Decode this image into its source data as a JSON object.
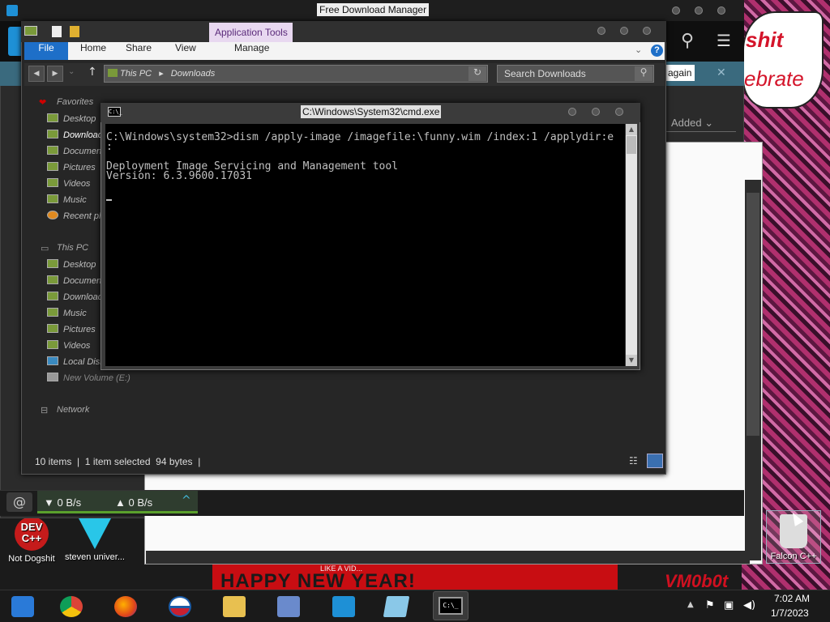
{
  "fdm": {
    "title": "Free Download Manager",
    "info_button": "again",
    "close_info": "✕",
    "column_added": "Added ⌄",
    "speed_down": "0 B/s",
    "speed_up": "0 B/s"
  },
  "explorer": {
    "ribbon_context": "Application Tools",
    "tabs": {
      "file": "File",
      "home": "Home",
      "share": "Share",
      "view": "View",
      "manage": "Manage"
    },
    "help": "?",
    "address": {
      "root": "This PC",
      "current": "Downloads"
    },
    "search_placeholder": "Search Downloads",
    "nav": {
      "favorites": "Favorites",
      "fav_items": [
        "Desktop",
        "Downloads",
        "Documents",
        "Pictures",
        "Videos",
        "Music",
        "Recent places"
      ],
      "this_pc": "This PC",
      "pc_items": [
        "Desktop",
        "Documents",
        "Downloads",
        "Music",
        "Pictures",
        "Videos",
        "Local Disk",
        "New Volume (E:)"
      ],
      "network": "Network"
    },
    "status": "10 items  |  1 item selected  94 bytes  |"
  },
  "cmd": {
    "title": "C:\\Windows\\System32\\cmd.exe",
    "icon_text": "C:\\_",
    "lines": "C:\\Windows\\system32>dism /apply-image /imagefile:\\funny.wim /index:1 /applydir:e\n:\n\nDeployment Image Servicing and Management tool\nVersion: 6.3.9600.17031"
  },
  "desktop": {
    "icons": {
      "devcpp": "Not Dogshit",
      "gem": "steven univer...",
      "recycle": "Falcon C++"
    },
    "devcpp_glyph": "DEV C++",
    "meme_line1": "shit",
    "meme_line2": "ebrate",
    "banner_sub": "LIKE A VID...",
    "banner_text": "HAPPY NEW YEAR!",
    "watermark": "VM0b0t"
  },
  "taskbar": {
    "apps": [
      "chrome-launcher",
      "chrome",
      "firefox",
      "obama-app",
      "file-explorer",
      "network-users",
      "fdm",
      "notepad",
      "cmd"
    ],
    "time": "7:02 AM",
    "date": "1/7/2023"
  },
  "colors": {
    "accent": "#1e6fc8",
    "console_bg": "#000000",
    "console_fg": "#c0c0c0",
    "speed_bar": "#5aa02c"
  }
}
